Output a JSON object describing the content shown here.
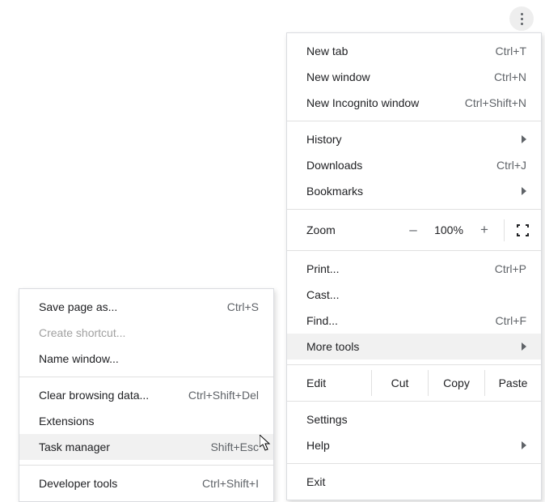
{
  "kebab_icon_name": "more-vertical-icon",
  "main_menu": {
    "section1": [
      {
        "label": "New tab",
        "shortcut": "Ctrl+T"
      },
      {
        "label": "New window",
        "shortcut": "Ctrl+N"
      },
      {
        "label": "New Incognito window",
        "shortcut": "Ctrl+Shift+N"
      }
    ],
    "section2": [
      {
        "label": "History",
        "submenu": true
      },
      {
        "label": "Downloads",
        "shortcut": "Ctrl+J"
      },
      {
        "label": "Bookmarks",
        "submenu": true
      }
    ],
    "zoom": {
      "label": "Zoom",
      "minus": "–",
      "value": "100%",
      "plus": "+",
      "fullscreen_icon": "fullscreen-icon"
    },
    "section3": [
      {
        "label": "Print...",
        "shortcut": "Ctrl+P"
      },
      {
        "label": "Cast..."
      },
      {
        "label": "Find...",
        "shortcut": "Ctrl+F"
      },
      {
        "label": "More tools",
        "submenu": true,
        "highlight": true
      }
    ],
    "edit": {
      "label": "Edit",
      "buttons": [
        "Cut",
        "Copy",
        "Paste"
      ]
    },
    "section4": [
      {
        "label": "Settings"
      },
      {
        "label": "Help",
        "submenu": true
      }
    ],
    "section5": [
      {
        "label": "Exit"
      }
    ]
  },
  "sub_menu": {
    "section1": [
      {
        "label": "Save page as...",
        "shortcut": "Ctrl+S"
      },
      {
        "label": "Create shortcut...",
        "disabled": true
      },
      {
        "label": "Name window..."
      }
    ],
    "section2": [
      {
        "label": "Clear browsing data...",
        "shortcut": "Ctrl+Shift+Del"
      },
      {
        "label": "Extensions"
      },
      {
        "label": "Task manager",
        "shortcut": "Shift+Esc",
        "highlight": true
      }
    ],
    "section3": [
      {
        "label": "Developer tools",
        "shortcut": "Ctrl+Shift+I"
      }
    ]
  }
}
